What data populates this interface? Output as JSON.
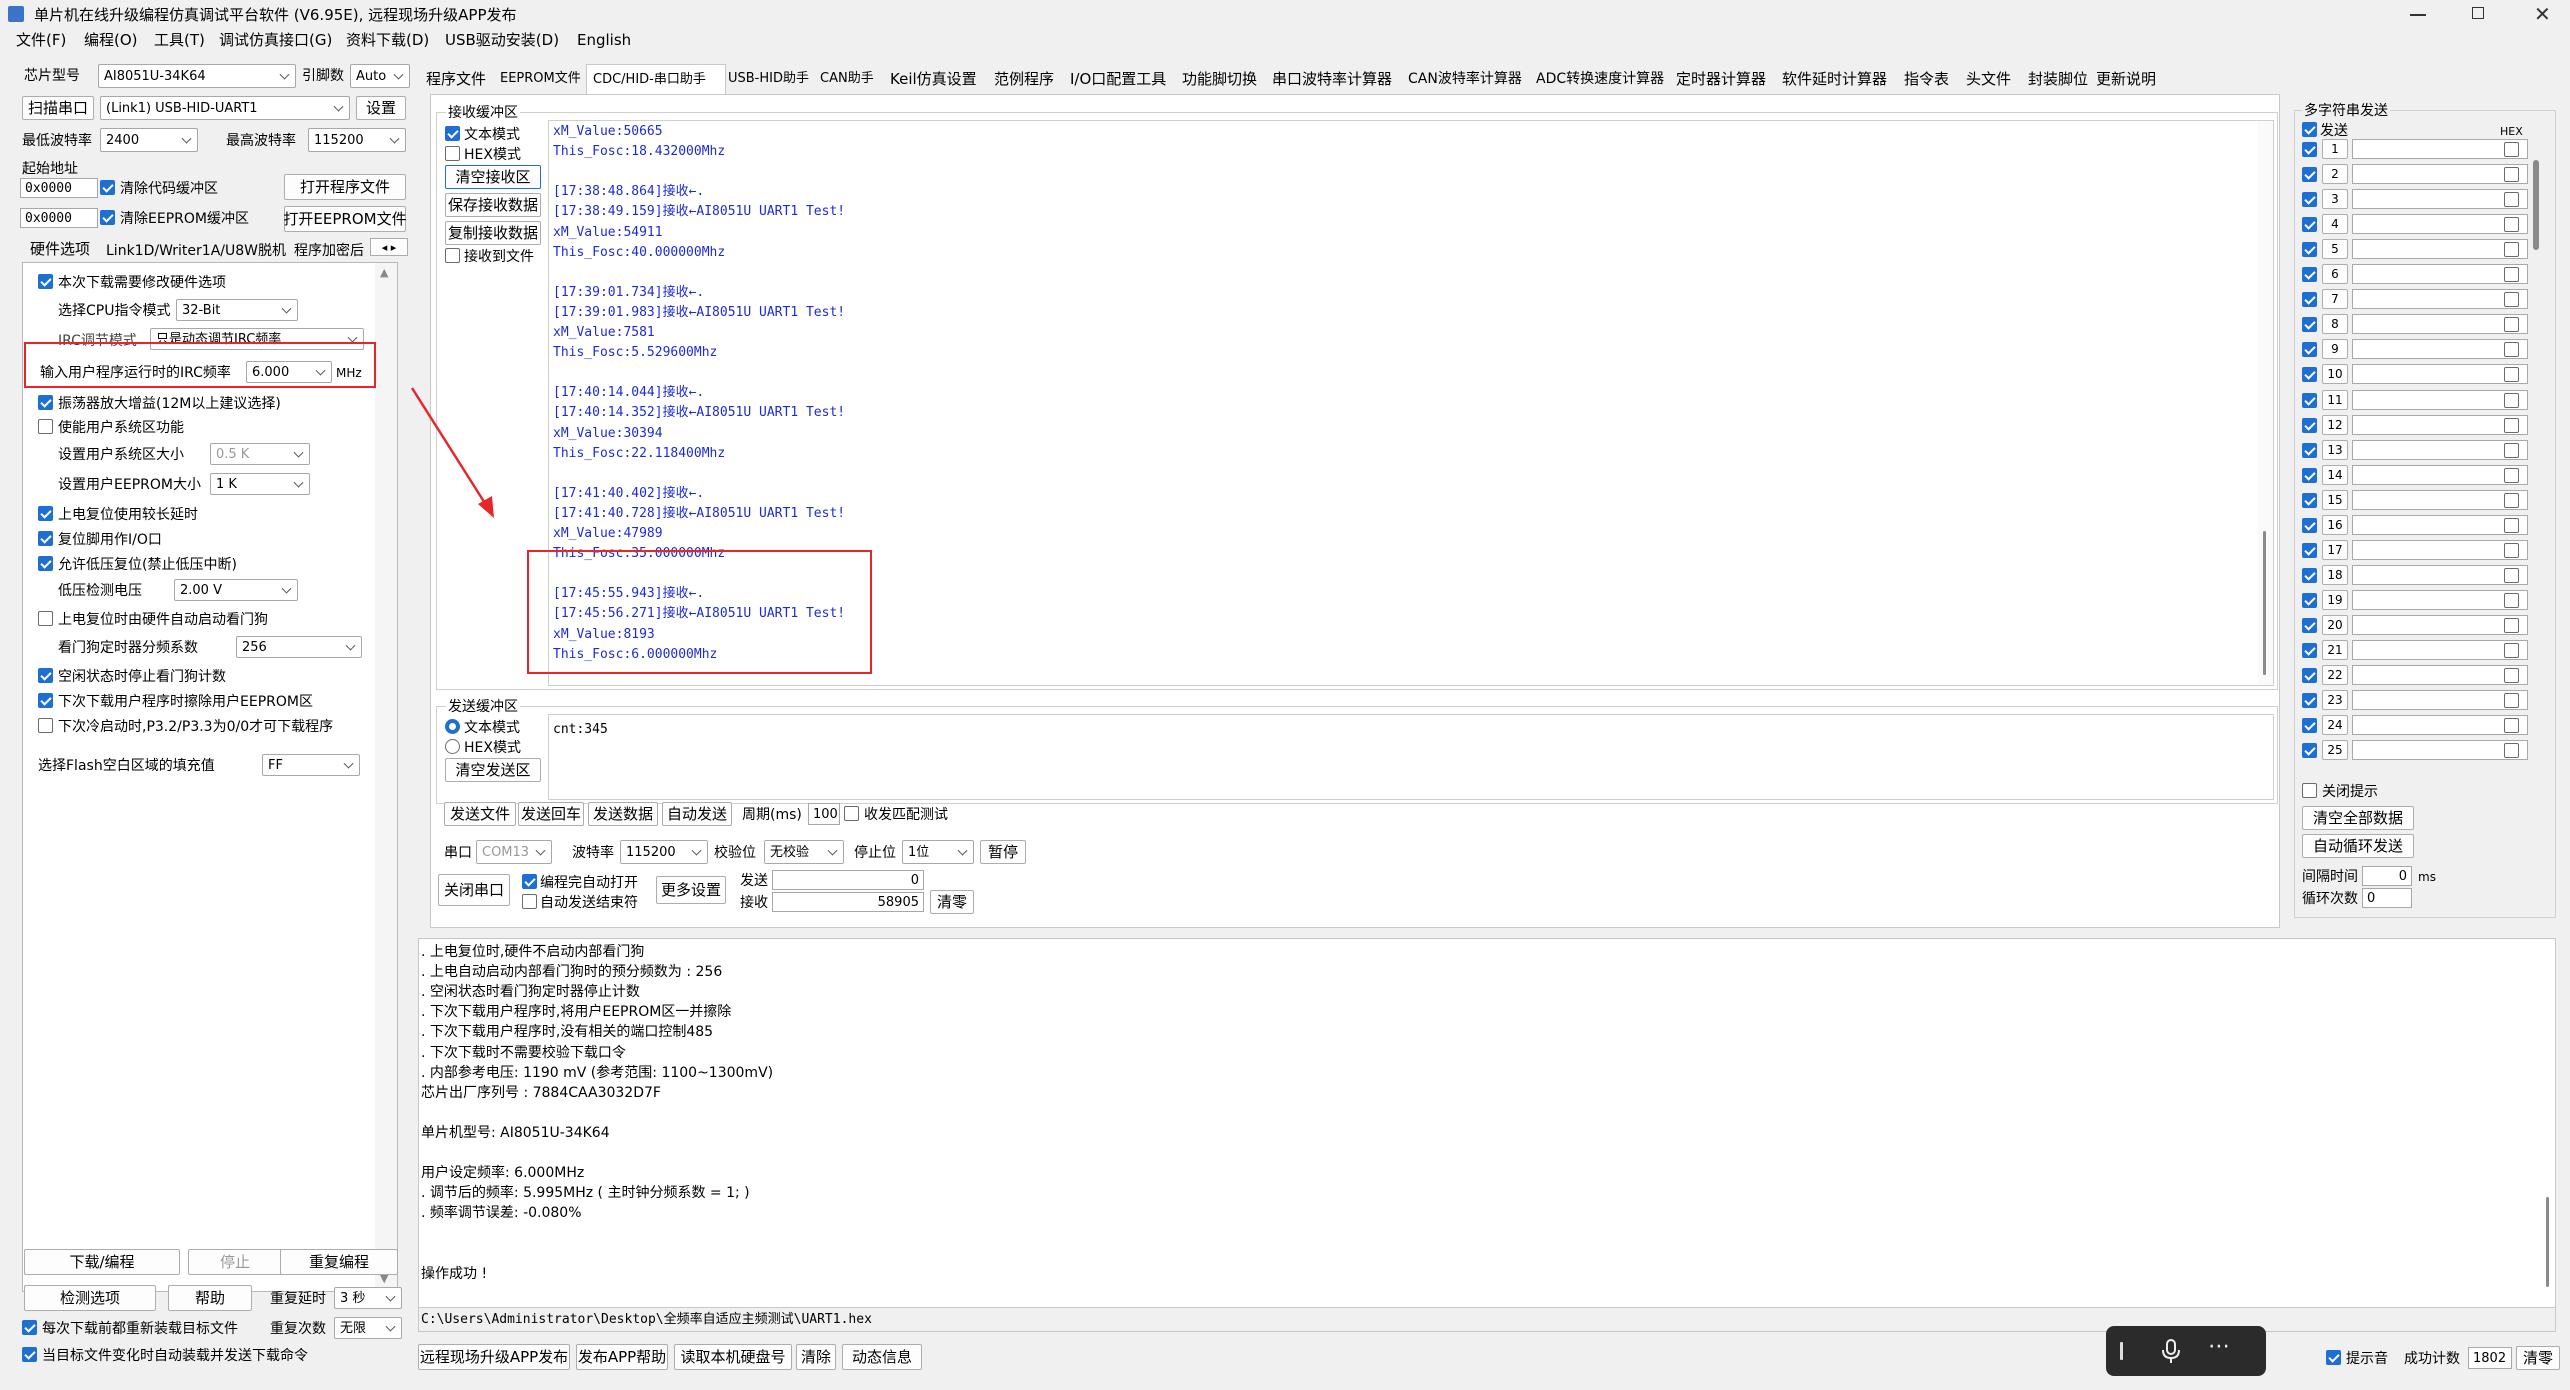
{
  "app": {
    "title": "单片机在线升级编程仿真调试平台软件 (V6.95E), 远程现场升级APP发布"
  },
  "menu": [
    "文件(F)",
    "编程(O)",
    "工具(T)",
    "调试仿真接口(G)",
    "资料下载(D)",
    "USB驱动安装(D)",
    "English"
  ],
  "left": {
    "chip_label": "芯片型号",
    "chip_value": "AI8051U-34K64",
    "pin_label": "引脚数",
    "pin_value": "Auto",
    "scan_label": "扫描串口",
    "port_value": "(Link1) USB-HID-UART1",
    "settings_btn": "设置",
    "min_baud_label": "最低波特率",
    "min_baud": "2400",
    "max_baud_label": "最高波特率",
    "max_baud": "115200",
    "start_addr_label": "起始地址",
    "addr1": "0x0000",
    "clear_code_label": "清除代码缓冲区",
    "open_prog_btn": "打开程序文件",
    "addr2": "0x0000",
    "clear_eeprom_label": "清除EEPROM缓冲区",
    "open_eeprom_btn": "打开EEPROM文件",
    "tabs": [
      "硬件选项",
      "Link1D/Writer1A/U8W脱机",
      "程序加密后"
    ],
    "opt_modify_hw": "本次下载需要修改硬件选项",
    "cpu_mode_label": "选择CPU指令模式",
    "cpu_mode": "32-Bit",
    "irc_adjust_label": "IRC调节模式",
    "irc_adjust_value": "只是动态调节IRC频率",
    "irc_freq_label": "输入用户程序运行时的IRC频率",
    "irc_freq": "6.000",
    "irc_unit": "MHz",
    "opt_osc_gain": "振荡器放大增益(12M以上建议选择)",
    "opt_user_sys": "使能用户系统区功能",
    "user_sys_size_label": "设置用户系统区大小",
    "user_sys_size": "0.5 K",
    "user_eeprom_size_label": "设置用户EEPROM大小",
    "user_eeprom_size": "1   K",
    "opt_long_delay": "上电复位使用较长延时",
    "opt_reset_io": "复位脚用作I/O口",
    "opt_lvr": "允许低压复位(禁止低压中断)",
    "lvd_label": "低压检测电压",
    "lvd_value": "2.00 V",
    "opt_wdt_auto": "上电复位时由硬件自动启动看门狗",
    "wdt_div_label": "看门狗定时器分频系数",
    "wdt_div": "256",
    "opt_idle_wdt": "空闲状态时停止看门狗计数",
    "opt_erase_eeprom": "下次下载用户程序时擦除用户EEPROM区",
    "opt_cold_boot": "下次冷启动时,P3.2/P3.3为0/0才可下载程序",
    "flash_fill_label": "选择Flash空白区域的填充值",
    "flash_fill": "FF",
    "download_btn": "下载/编程",
    "stop_btn": "停止",
    "reprog_btn": "重复编程",
    "check_btn": "检测选项",
    "help_btn": "帮助",
    "repeat_delay_label": "重复延时",
    "repeat_delay": "3 秒",
    "repeat_count_label": "重复次数",
    "repeat_count": "无限",
    "opt_reload": "每次下载前都重新装载目标文件",
    "opt_auto_load": "当目标文件变化时自动装载并发送下载命令"
  },
  "tabs": [
    "程序文件",
    "EEPROM文件",
    "CDC/HID-串口助手",
    "USB-HID助手",
    "CAN助手",
    "Keil仿真设置",
    "范例程序",
    "I/O口配置工具",
    "功能脚切换",
    "串口波特率计算器",
    "CAN波特率计算器",
    "ADC转换速度计算器",
    "定时器计算器",
    "软件延时计算器",
    "指令表",
    "头文件",
    "封装脚位",
    "更新说明"
  ],
  "serial": {
    "recv_title": "接收缓冲区",
    "text_mode": "文本模式",
    "hex_mode": "HEX模式",
    "clear_recv": "清空接收区",
    "save_recv": "保存接收数据",
    "copy_recv": "复制接收数据",
    "recv_to_file": "接收到文件",
    "recv_lines": [
      "xM_Value:50665",
      "This_Fosc:18.432000Mhz",
      "",
      "[17:38:48.864]接收←.",
      "[17:38:49.159]接收←AI8051U UART1 Test!",
      "xM_Value:54911",
      "This_Fosc:40.000000Mhz",
      "",
      "[17:39:01.734]接收←.",
      "[17:39:01.983]接收←AI8051U UART1 Test!",
      "xM_Value:7581",
      "This_Fosc:5.529600Mhz",
      "",
      "[17:40:14.044]接收←.",
      "[17:40:14.352]接收←AI8051U UART1 Test!",
      "xM_Value:30394",
      "This_Fosc:22.118400Mhz",
      "",
      "[17:41:40.402]接收←.",
      "[17:41:40.728]接收←AI8051U UART1 Test!",
      "xM_Value:47989",
      "This_Fosc:35.000000Mhz",
      "",
      "[17:45:55.943]接收←.",
      "[17:45:56.271]接收←AI8051U UART1 Test!",
      "xM_Value:8193",
      "This_Fosc:6.000000Mhz"
    ],
    "send_title": "发送缓冲区",
    "send_text_mode": "文本模式",
    "send_hex_mode": "HEX模式",
    "clear_send": "清空发送区",
    "send_content": "cnt:345",
    "send_file": "发送文件",
    "send_enter": "发送回车",
    "send_data": "发送数据",
    "auto_send": "自动发送",
    "period_label": "周期(ms)",
    "period": "100",
    "match_test": "收发匹配测试",
    "port_label": "串口",
    "port": "COM13",
    "baud_label": "波特率",
    "baud": "115200",
    "parity_label": "校验位",
    "parity": "无校验",
    "stop_label": "停止位",
    "stop": "1位",
    "pause_btn": "暂停",
    "close_port": "关闭串口",
    "auto_open": "编程完自动打开",
    "auto_end": "自动发送结束符",
    "more_settings": "更多设置",
    "send_cnt_label": "发送",
    "send_cnt": "0",
    "recv_cnt_label": "接收",
    "recv_cnt": "58905",
    "clear_cnt": "清零"
  },
  "multi": {
    "title": "多字符串发送",
    "send_label": "发送",
    "hex_label": "HEX",
    "rows": [
      "1",
      "2",
      "3",
      "4",
      "5",
      "6",
      "7",
      "8",
      "9",
      "10",
      "11",
      "12",
      "13",
      "14",
      "15",
      "16",
      "17",
      "18",
      "19",
      "20",
      "21",
      "22",
      "23",
      "24",
      "25"
    ],
    "close_hint": "关闭提示",
    "clear_all": "清空全部数据",
    "auto_loop": "自动循环发送",
    "interval_label": "间隔时间",
    "interval": "0",
    "interval_unit": "ms",
    "loop_label": "循环次数",
    "loop": "0"
  },
  "log": {
    "lines": [
      ". 上电复位时,硬件不启动内部看门狗",
      ". 上电自动启动内部看门狗时的预分频数为 : 256",
      ". 空闲状态时看门狗定时器停止计数",
      ". 下次下载用户程序时,将用户EEPROM区一并擦除",
      ". 下次下载用户程序时,没有相关的端口控制485",
      ". 下次下载时不需要校验下载口令",
      ". 内部参考电压: 1190 mV (参考范围: 1100~1300mV)",
      "芯片出厂序列号 : 7884CAA3032D7F",
      "",
      "单片机型号: AI8051U-34K64",
      "",
      "用户设定频率: 6.000MHz",
      ". 调节后的频率: 5.995MHz ( 主时钟分频系数 = 1; )",
      ". 频率调节误差: -0.080%",
      "",
      "",
      "操作成功 !"
    ],
    "path": "C:\\Users\\Administrator\\Desktop\\全频率自适应主频测试\\UART1.hex"
  },
  "bottom": {
    "remote_app": "远程现场升级APP发布",
    "publish_help": "发布APP帮助",
    "read_disk": "读取本机硬盘号",
    "clear": "清除",
    "dyn_info": "动态信息",
    "hint_label": "提示音",
    "success_label": "成功计数",
    "success_count": "1802",
    "clear_btn": "清零"
  },
  "colors": {
    "accent": "#1d6fd1",
    "highlight_red": "#e8262a",
    "recv_text": "#1d2bd6"
  }
}
